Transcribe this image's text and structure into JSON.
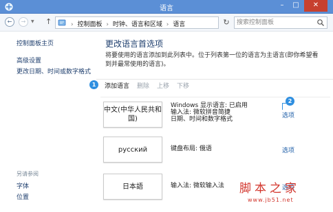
{
  "window": {
    "title": "语言",
    "min_icon": "minimize-icon",
    "max_icon": "maximize-icon",
    "close_icon": "close-icon"
  },
  "nav": {
    "back_glyph": "←",
    "forward_glyph": "→",
    "up_glyph": "↑",
    "breadcrumbs": [
      "控制面板",
      "时钟、语言和区域",
      "语言"
    ],
    "search_placeholder": "搜索控制面板"
  },
  "sidebar": {
    "home": "控制面板主页",
    "links": [
      "高级设置",
      "更改日期、时间或数字格式"
    ],
    "see_also_title": "另请参阅",
    "see_also": [
      "字体",
      "位置"
    ]
  },
  "main": {
    "heading": "更改语言首选项",
    "description": "将要使用的语言添加到此列表中。位于列表第一位的语言为主语言(即你希望看到并最常使用的语言)。",
    "toolbar": {
      "add": "添加语言",
      "remove": "删除",
      "up": "上移",
      "down": "下移"
    },
    "callouts": [
      "1",
      "2"
    ],
    "languages": [
      {
        "name": "中文(中华人民共和国)",
        "details": [
          "Windows 显示语言: 已启用",
          "输入法: 微软拼音简捷",
          "日期、时间和数字格式"
        ],
        "options": "选项"
      },
      {
        "name": "русский",
        "details": [
          "键盘布局: 俄语"
        ],
        "options": "选项"
      },
      {
        "name": "日本語",
        "details": [
          "输入法: 微软输入法"
        ],
        "options": "选项"
      }
    ]
  },
  "watermark": {
    "text": "脚本之家",
    "url": "www.jb51.net"
  },
  "colors": {
    "titlebar": "#5b8fd6",
    "close": "#c7402f",
    "link": "#1f3f6e",
    "options_link": "#1f5fa8",
    "callout": "#2f8fe0",
    "watermark": "#d2342b"
  }
}
